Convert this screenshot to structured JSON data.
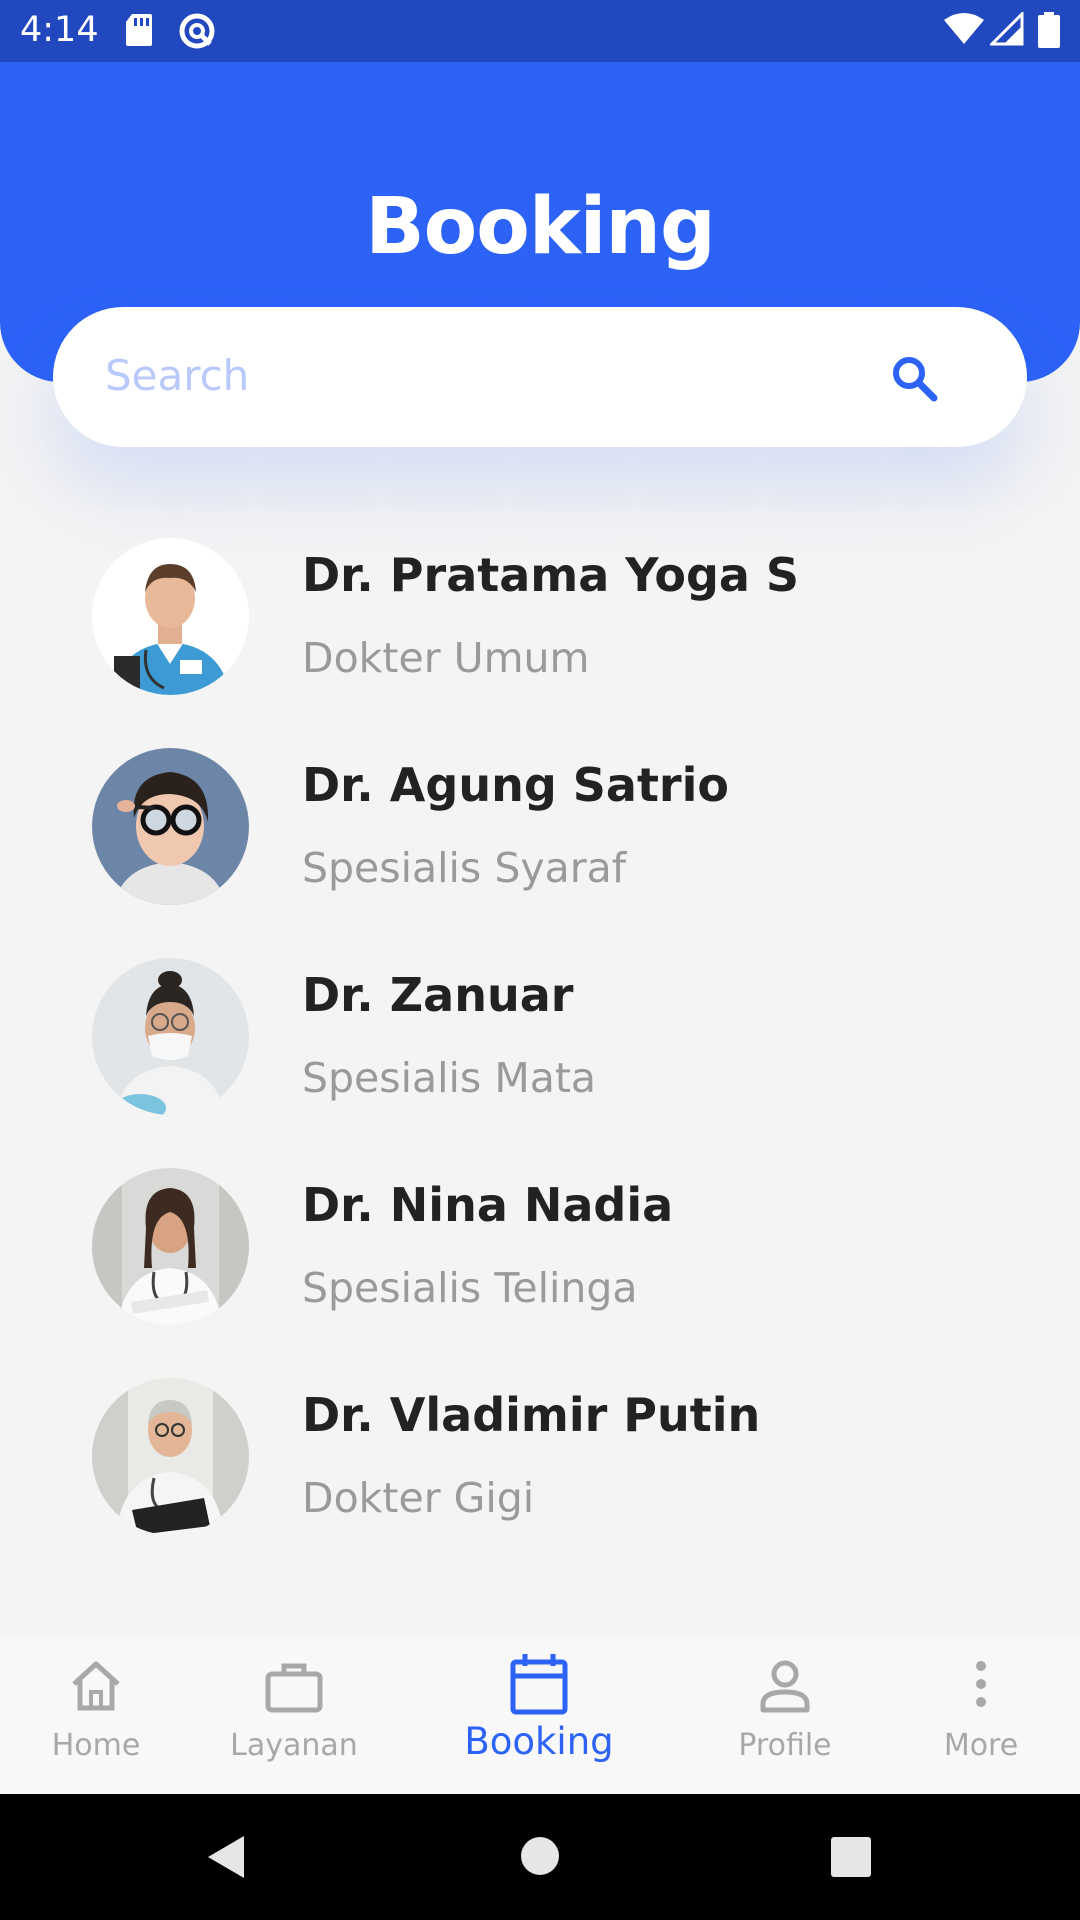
{
  "status_bar": {
    "time": "4:14"
  },
  "header": {
    "title": "Booking"
  },
  "search": {
    "placeholder": "Search"
  },
  "doctors": [
    {
      "name": "Dr. Pratama Yoga S",
      "specialty": "Dokter Umum"
    },
    {
      "name": "Dr. Agung Satrio",
      "specialty": "Spesialis Syaraf"
    },
    {
      "name": "Dr. Zanuar",
      "specialty": "Spesialis Mata"
    },
    {
      "name": "Dr. Nina Nadia",
      "specialty": "Spesialis Telinga"
    },
    {
      "name": "Dr. Vladimir Putin",
      "specialty": "Dokter Gigi"
    }
  ],
  "nav": [
    {
      "label": "Home",
      "icon": "home-icon"
    },
    {
      "label": "Layanan",
      "icon": "briefcase-icon"
    },
    {
      "label": "Booking",
      "icon": "calendar-icon",
      "active": true
    },
    {
      "label": "Profile",
      "icon": "person-icon"
    },
    {
      "label": "More",
      "icon": "more-vertical-icon"
    }
  ],
  "colors": {
    "primary": "#2c62f6",
    "status_bar": "#2248c0",
    "background": "#f4f4f4",
    "name_text": "#222222",
    "specialty_text": "#9a9a9a",
    "nav_inactive": "#a8a8a8"
  }
}
